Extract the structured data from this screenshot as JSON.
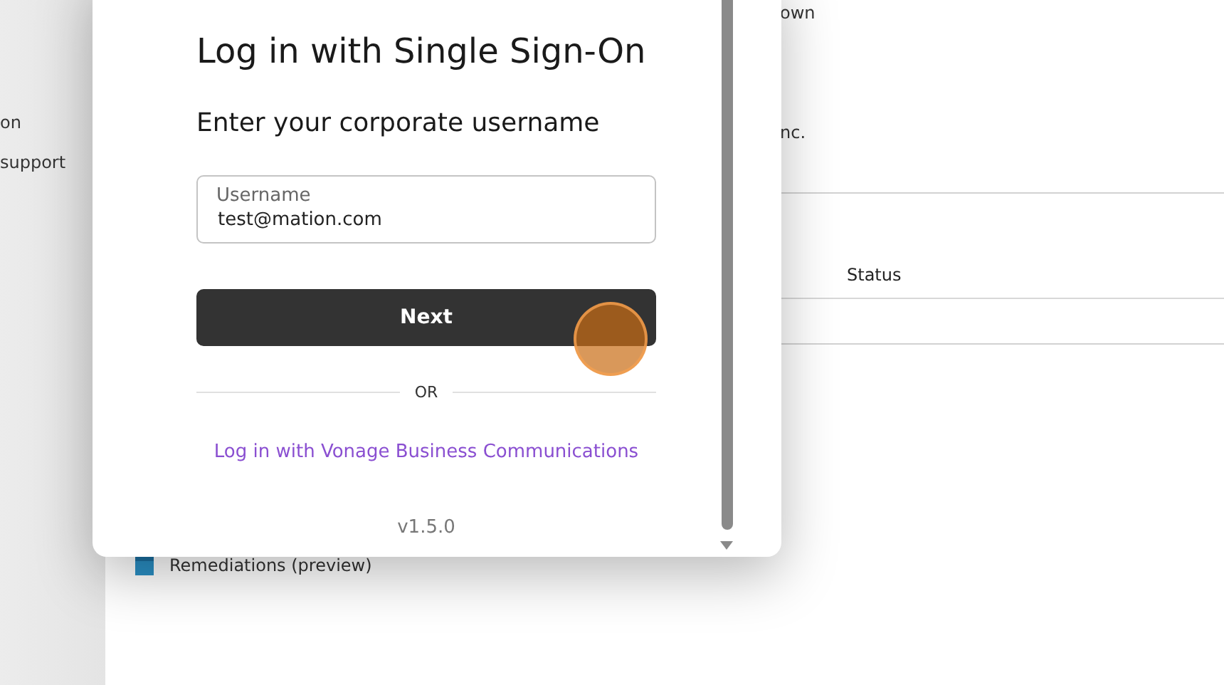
{
  "sidebar": {
    "items": [
      "on",
      "support"
    ]
  },
  "background": {
    "header_texts": [
      "own",
      "nc."
    ],
    "table": {
      "columns": [
        "Status"
      ]
    },
    "nav_item": "Remediations (preview)"
  },
  "dialog": {
    "title": "Log in with Single Sign-On",
    "subtitle": "Enter your corporate username",
    "username": {
      "label": "Username",
      "value": "test@mation.com"
    },
    "next_button": "Next",
    "divider": "OR",
    "alt_link": "Log in with Vonage Business Communications",
    "version": "v1.5.0"
  }
}
